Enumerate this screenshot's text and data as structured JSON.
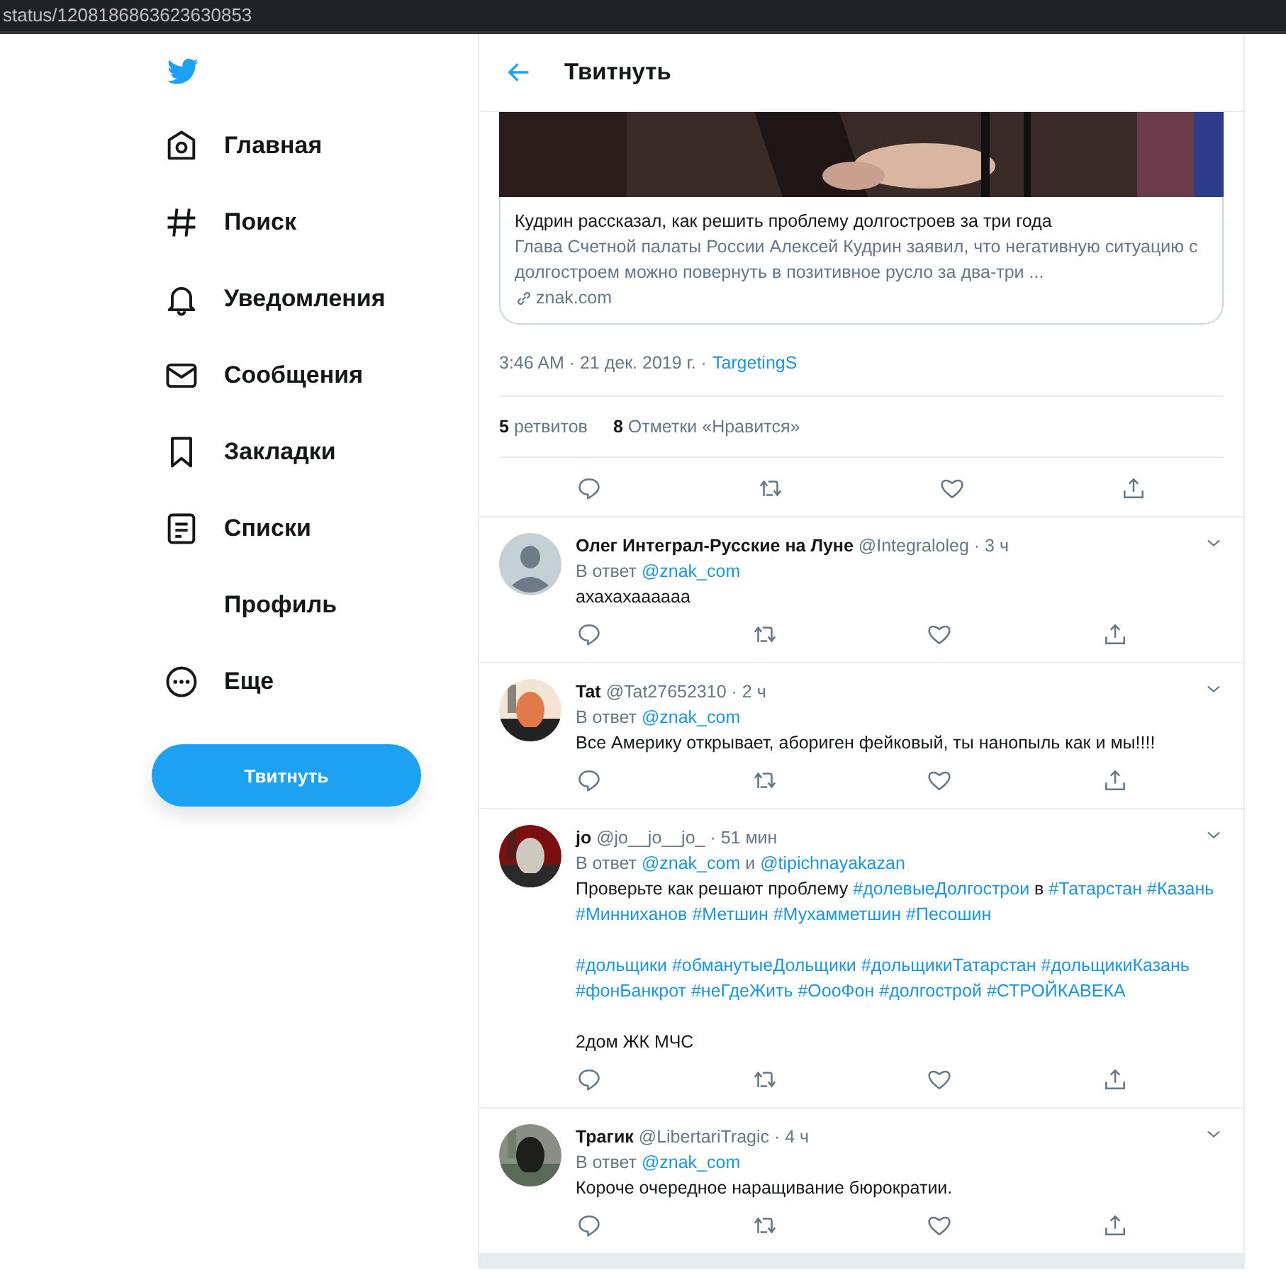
{
  "address_bar": {
    "url": "status/1208186863623630853"
  },
  "nav": {
    "items": [
      {
        "label": "Главная",
        "kind": "home"
      },
      {
        "label": "Поиск",
        "kind": "hash"
      },
      {
        "label": "Уведомления",
        "kind": "bell"
      },
      {
        "label": "Сообщения",
        "kind": "mail"
      },
      {
        "label": "Закладки",
        "kind": "bookmark"
      },
      {
        "label": "Списки",
        "kind": "list"
      },
      {
        "label": "Профиль",
        "kind": "profile"
      },
      {
        "label": "Еще",
        "kind": "more"
      }
    ],
    "tweet_button": "Твитнуть"
  },
  "header": {
    "title": "Твитнуть"
  },
  "link_card": {
    "title": "Кудрин рассказал, как решить проблему долгостроев за три года",
    "description": "Глава Счетной палаты России Алексей Кудрин заявил, что негативную ситуацию с долгостроем можно повернуть в позитивное русло за два-три ...",
    "domain": "znak.com"
  },
  "meta": {
    "time": "3:46 AM · 21 дек. 2019 г. ·",
    "source": "TargetingS"
  },
  "stats": [
    {
      "count": "5",
      "label": "ретвитов"
    },
    {
      "count": "8",
      "label": "Отметки «Нравится»"
    }
  ],
  "replies": [
    {
      "kind": "default",
      "name": "Олег Интеграл-Русские на Луне",
      "handle": "@Integraloleg · 3 ч",
      "reply_to": [
        {
          "text": "В ответ",
          "kind": "plain"
        },
        {
          "text": "@znak_com",
          "kind": "link"
        }
      ],
      "paragraphs": [
        [
          {
            "text": "ахахахаааааа",
            "kind": "plain"
          }
        ]
      ]
    },
    {
      "name": "Tat",
      "handle": "@Tat27652310 · 2 ч",
      "reply_to": [
        {
          "text": "В ответ",
          "kind": "plain"
        },
        {
          "text": "@znak_com",
          "kind": "link"
        }
      ],
      "paragraphs": [
        [
          {
            "text": "Все Америку открывает, абориген фейковый, ты нанопыль как и мы!!!!",
            "kind": "plain"
          }
        ]
      ]
    },
    {
      "name": "jo",
      "handle": "@jo__jo__jo_ · 51 мин",
      "reply_to": [
        {
          "text": "В ответ",
          "kind": "plain"
        },
        {
          "text": "@znak_com",
          "kind": "link"
        },
        {
          "text": "и",
          "kind": "plain"
        },
        {
          "text": "@tipichnayakazan",
          "kind": "link"
        }
      ],
      "paragraphs": [
        [
          {
            "text": "Проверьте как решают проблему",
            "kind": "plain"
          },
          {
            "text": "#долевыеДолгострои",
            "kind": "link"
          },
          {
            "text": "в",
            "kind": "plain"
          },
          {
            "text": "#Татарстан",
            "kind": "link"
          },
          {
            "text": "#Казань",
            "kind": "link"
          },
          {
            "text": "#Минниханов",
            "kind": "link"
          },
          {
            "text": "#Метшин",
            "kind": "link"
          },
          {
            "text": "#Мухамметшин",
            "kind": "link"
          },
          {
            "text": "#Песошин",
            "kind": "link"
          }
        ],
        [
          {
            "text": "#дольщики",
            "kind": "link"
          },
          {
            "text": "#обманутыеДольщики",
            "kind": "link"
          },
          {
            "text": "#дольщикиТатарстан",
            "kind": "link"
          },
          {
            "text": "#дольщикиКазань",
            "kind": "link"
          },
          {
            "text": "#фонБанкрот",
            "kind": "link"
          },
          {
            "text": "#неГдеЖить",
            "kind": "link"
          },
          {
            "text": "#ОооФон",
            "kind": "link"
          },
          {
            "text": "#долгострой",
            "kind": "link"
          },
          {
            "text": "#СТРОЙКАВЕКА",
            "kind": "link"
          }
        ],
        [
          {
            "text": "2дом ЖК МЧС",
            "kind": "plain"
          }
        ]
      ]
    },
    {
      "name": "Трагик",
      "handle": "@LibertariTragic · 4 ч",
      "reply_to": [
        {
          "text": "В ответ",
          "kind": "plain"
        },
        {
          "text": "@znak_com",
          "kind": "link"
        }
      ],
      "paragraphs": [
        [
          {
            "text": "Короче очередное наращивание бюрократии.",
            "kind": "plain"
          }
        ]
      ]
    }
  ]
}
